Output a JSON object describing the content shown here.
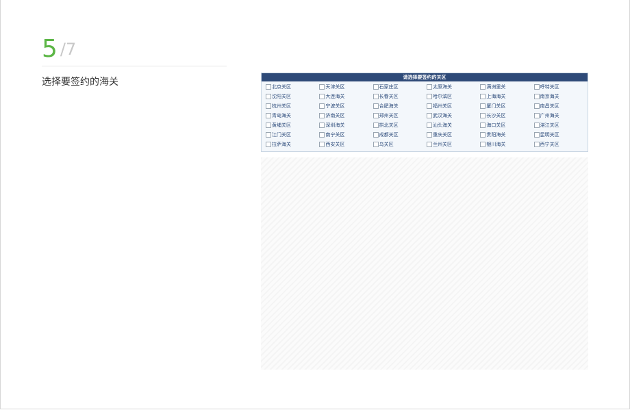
{
  "step": {
    "current": "5",
    "total": "/7",
    "description": "选择要签约的海关"
  },
  "customs_panel": {
    "title": "请选择要签约的关区",
    "items": [
      "北京关区",
      "天津关区",
      "石家庄区",
      "太原海关",
      "满洲里关",
      "呼特关区",
      "沈阳关区",
      "大连海关",
      "长春关区",
      "哈尔滨区",
      "上海海关",
      "南京海关",
      "杭州关区",
      "宁波关区",
      "合肥海关",
      "福州关区",
      "厦门关区",
      "南昌关区",
      "青岛海关",
      "济南关区",
      "郑州关区",
      "武汉海关",
      "长沙关区",
      "广州海关",
      "黄埔关区",
      "深圳海关",
      "拱北关区",
      "汕头海关",
      "海口关区",
      "湛江关区",
      "江门关区",
      "南宁关区",
      "成都关区",
      "重庆关区",
      "贵阳海关",
      "昆明关区",
      "拉萨海关",
      "西安关区",
      "乌关区",
      "兰州关区",
      "银川海关",
      "西宁关区"
    ]
  },
  "colors": {
    "accent_green": "#5cb646",
    "header_blue": "#2e4a78",
    "muted_gray": "#c8c8c8"
  }
}
